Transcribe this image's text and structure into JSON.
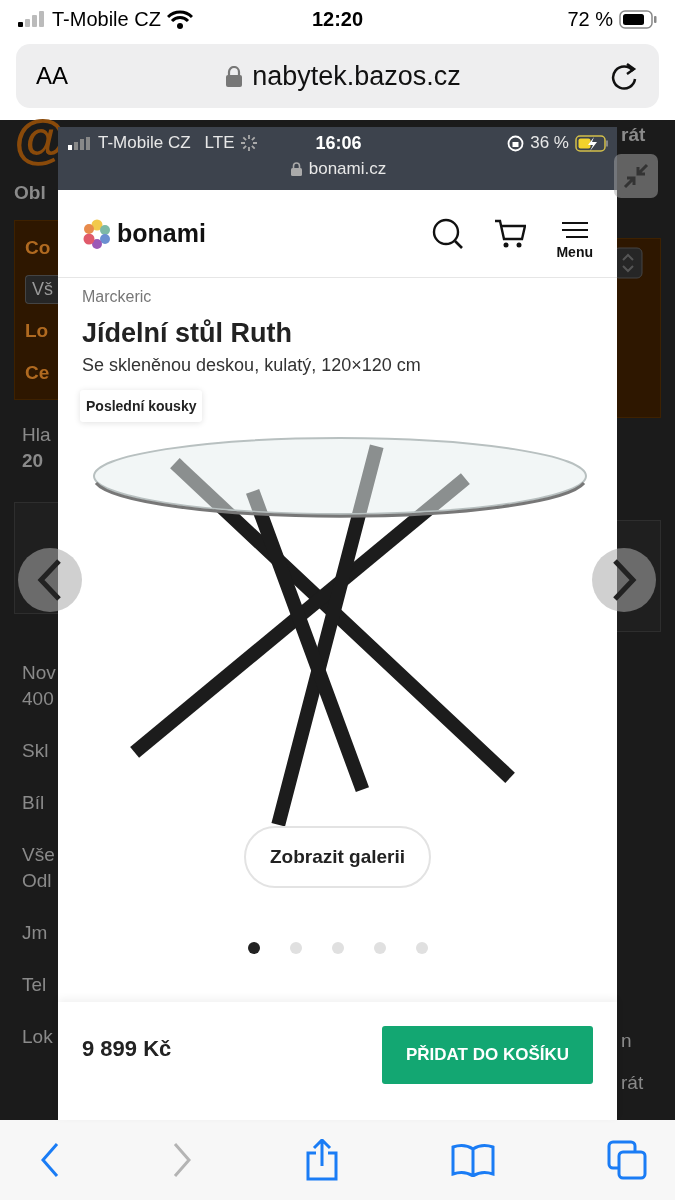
{
  "phone_status": {
    "carrier": "T-Mobile CZ",
    "time": "12:20",
    "battery": "72 %"
  },
  "browser": {
    "text_size": "AA",
    "url": "nabytek.bazos.cz"
  },
  "background_page": {
    "logo": "@",
    "region": "Obl",
    "filter_box": [
      {
        "kind": "label",
        "text": "Co"
      },
      {
        "kind": "select",
        "text": "Vš"
      },
      {
        "kind": "label",
        "text": "Lo"
      },
      {
        "kind": "label",
        "text": "Ce"
      }
    ],
    "paragraphs": [
      [
        "Hla",
        "20"
      ]
    ],
    "listing": [
      [
        "Nov",
        "400"
      ],
      [
        "Skl"
      ],
      [
        "Bíl"
      ],
      [
        "Vše",
        "Odl"
      ],
      [
        "Jm"
      ],
      [
        "Tel"
      ],
      [
        "Lok"
      ]
    ],
    "right_top": "rát",
    "right_bottom": [
      "n",
      "rát"
    ]
  },
  "screenshot": {
    "status_bar": {
      "carrier": "T-Mobile CZ",
      "network": "LTE",
      "time": "16:06",
      "battery": "36 %",
      "url": "bonami.cz"
    },
    "logo": "bonami",
    "menu_label": "Menu",
    "brand": "Marckeric",
    "title": "Jídelní stůl Ruth",
    "subtitle": "Se skleněnou deskou, kulatý, 120×120 cm",
    "badge": "Poslední kousky",
    "gallery_button": "Zobrazit galerii",
    "dots": [
      {
        "selected": true
      },
      {
        "selected": false
      },
      {
        "selected": false
      },
      {
        "selected": false
      },
      {
        "selected": false
      }
    ],
    "price": "9 899 Kč",
    "cart_button": "PŘIDAT DO KOŠÍKU"
  },
  "toolbar": [
    {
      "kind": "back",
      "disabled": false
    },
    {
      "kind": "forward",
      "disabled": true
    },
    {
      "kind": "share",
      "disabled": false
    },
    {
      "kind": "bookmarks",
      "disabled": false
    },
    {
      "kind": "tabs",
      "disabled": false
    }
  ]
}
